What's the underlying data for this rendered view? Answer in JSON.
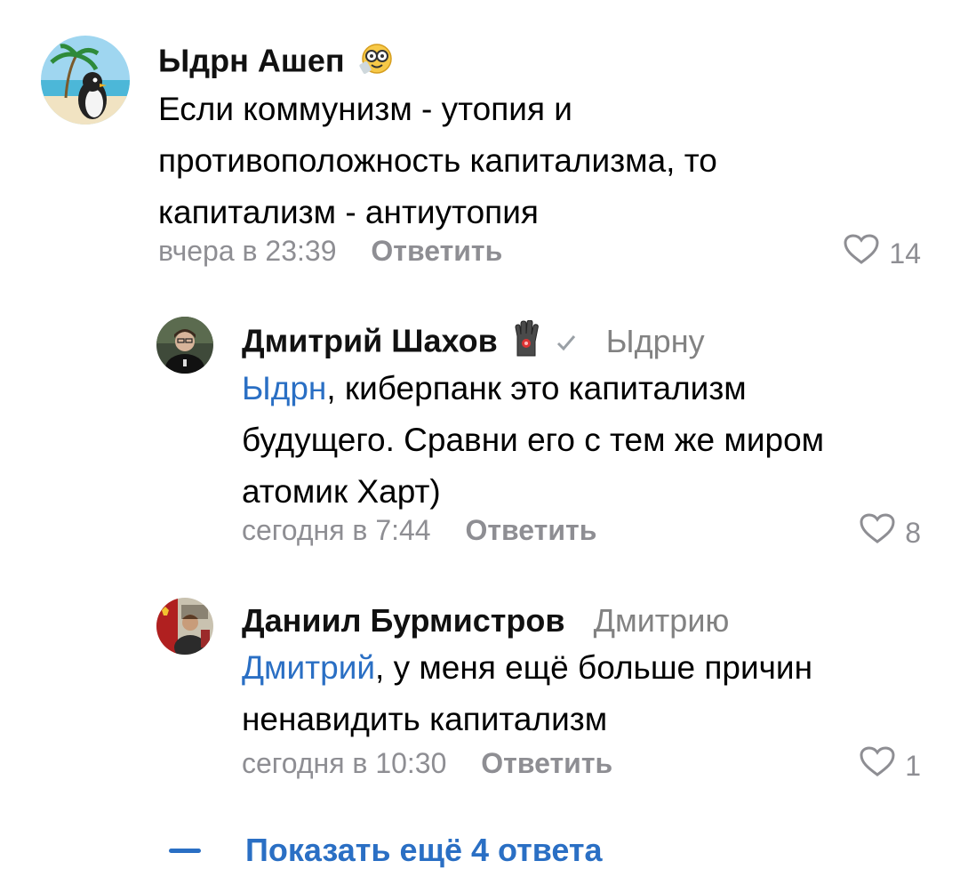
{
  "comments": [
    {
      "author": "Ыдрн Ашеп",
      "emoji_icon": "nerd-face-emoji-icon",
      "text_lines": [
        "Если коммунизм - утопия и",
        "противоположность капитализма, то",
        "капитализм - антиутопия"
      ],
      "time": "вчера в 23:39",
      "reply_label": "Ответить",
      "likes": "14"
    },
    {
      "author": "Дмитрий Шахов",
      "emoji_icon": "cyber-hand-emoji-icon",
      "verified_icon": "check-icon",
      "reply_to": "Ыдрну",
      "mention": "Ыдрн",
      "text_first_rest": ", киберпанк это капитализм",
      "text_lines": [
        "будущего. Сравни его с тем же миром",
        "атомик Харт)"
      ],
      "time": "сегодня в 7:44",
      "reply_label": "Ответить",
      "likes": "8"
    },
    {
      "author": "Даниил Бурмистров",
      "reply_to": "Дмитрию",
      "mention": "Дмитрий",
      "text_first_rest": ", у меня ещё больше причин",
      "text_lines": [
        "ненавидить капитализм"
      ],
      "time": "сегодня в 10:30",
      "reply_label": "Ответить",
      "likes": "1"
    }
  ],
  "show_more": {
    "label": "Показать ещё 4 ответа"
  },
  "colors": {
    "link": "#2a6fc4",
    "muted": "#8e8e93",
    "text": "#000000"
  }
}
